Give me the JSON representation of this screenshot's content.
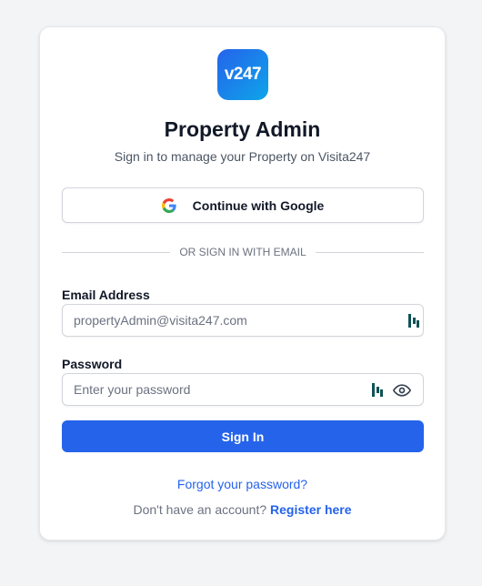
{
  "logo": {
    "text": "v247"
  },
  "header": {
    "title": "Property Admin",
    "subtitle": "Sign in to manage your Property on Visita247"
  },
  "google": {
    "label": "Continue with Google",
    "icon": "google-icon"
  },
  "divider": {
    "text": "OR SIGN IN WITH EMAIL"
  },
  "email": {
    "label": "Email Address",
    "value": "",
    "placeholder": "propertyAdmin@visita247.com",
    "icon": "password-manager-icon"
  },
  "password": {
    "label": "Password",
    "value": "",
    "placeholder": "Enter your password",
    "icons": [
      "password-manager-icon",
      "eye-icon"
    ]
  },
  "actions": {
    "signin_label": "Sign In",
    "forgot_label": "Forgot your password?",
    "register_prompt": "Don't have an account?",
    "register_link": "Register here"
  },
  "colors": {
    "primary": "#2563eb",
    "logo_gradient_start": "#2563eb",
    "logo_gradient_end": "#0ea5e9",
    "page_background": "#f3f4f6",
    "pm_icon": "#0f5257"
  }
}
